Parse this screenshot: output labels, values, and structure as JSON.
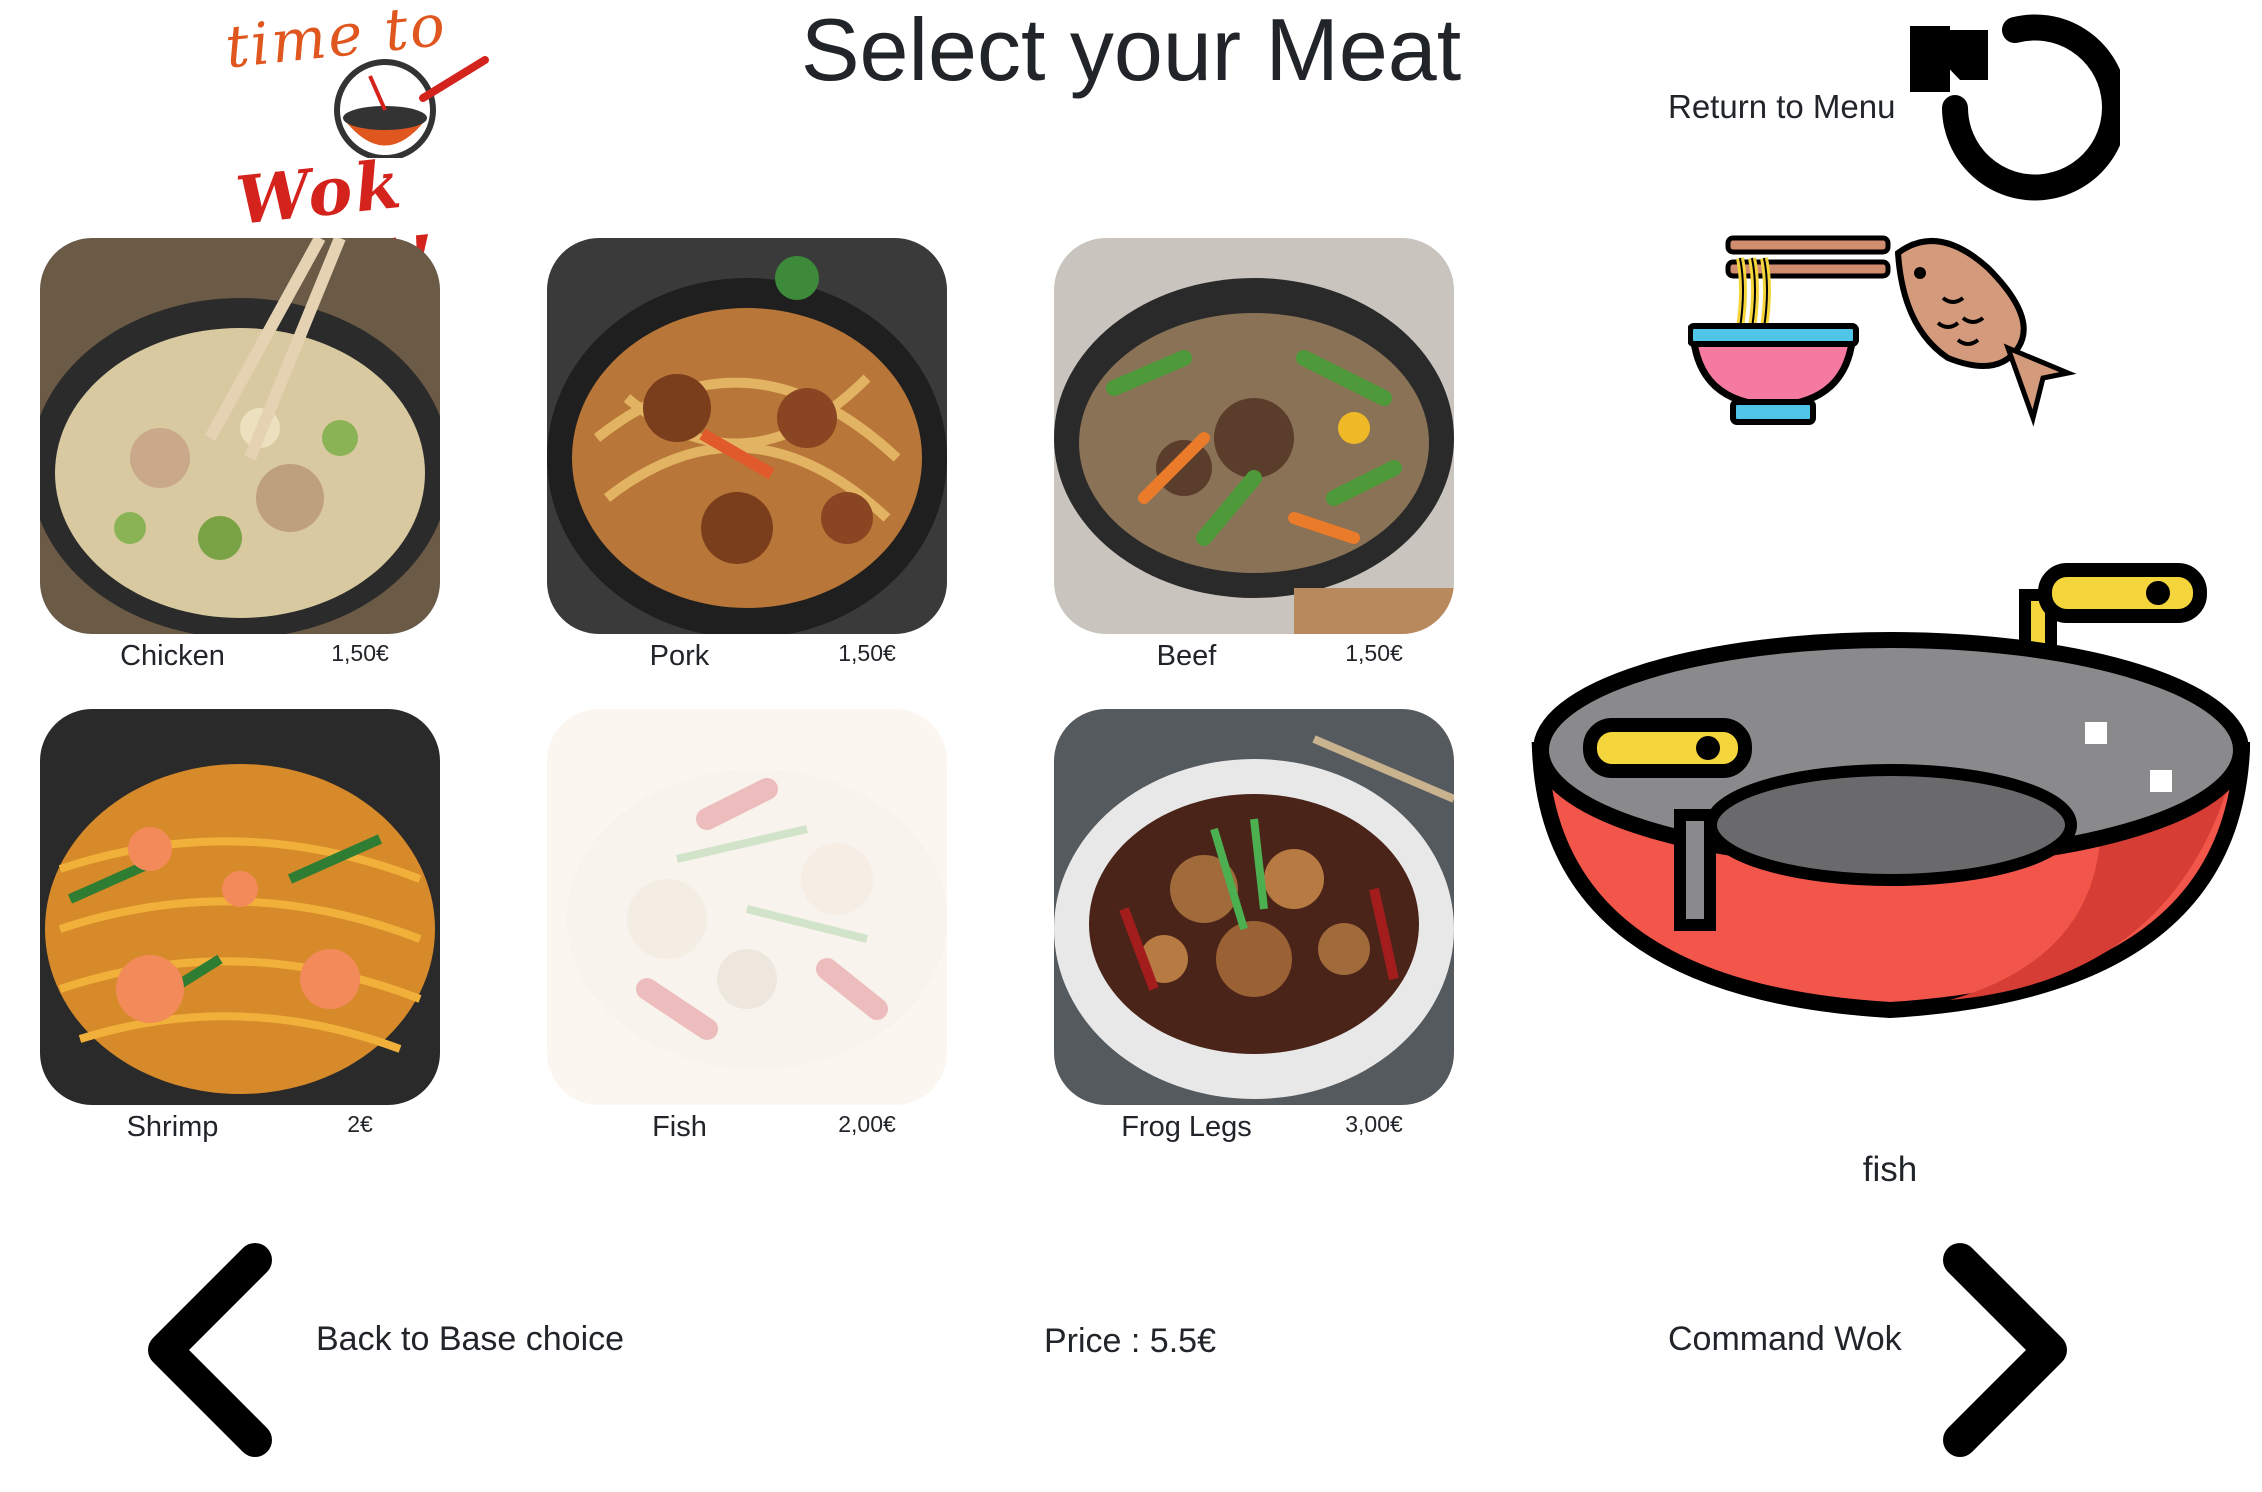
{
  "logo": {
    "line1": "time to",
    "line2": "Wok uP !!"
  },
  "header": {
    "title": "Select your Meat",
    "return_label": "Return to Menu"
  },
  "meats": [
    {
      "name": "Chicken",
      "price": "1,50€",
      "dimmed": false
    },
    {
      "name": "Pork",
      "price": "1,50€",
      "dimmed": false
    },
    {
      "name": "Beef",
      "price": "1,50€",
      "dimmed": false
    },
    {
      "name": "Shrimp",
      "price": "2€",
      "dimmed": false
    },
    {
      "name": "Fish",
      "price": "2,00€",
      "dimmed": true
    },
    {
      "name": "Frog Legs",
      "price": "3,00€",
      "dimmed": false
    }
  ],
  "selection": {
    "current": "fish"
  },
  "footer": {
    "back_label": "Back to Base choice",
    "price_label": "Price : 5.5€",
    "command_label": "Command Wok"
  },
  "icons": {
    "return": "rotate-ccw-icon",
    "base": "noodle-bowl-icon",
    "meat": "fish-icon",
    "wok": "wok-icon",
    "back": "chevron-left-icon",
    "next": "chevron-right-icon"
  },
  "colors": {
    "text": "#212529",
    "wok_red": "#f2564b",
    "wok_handle": "#f5d53c",
    "logo_orange": "#e0561f",
    "logo_red": "#d4231c"
  }
}
